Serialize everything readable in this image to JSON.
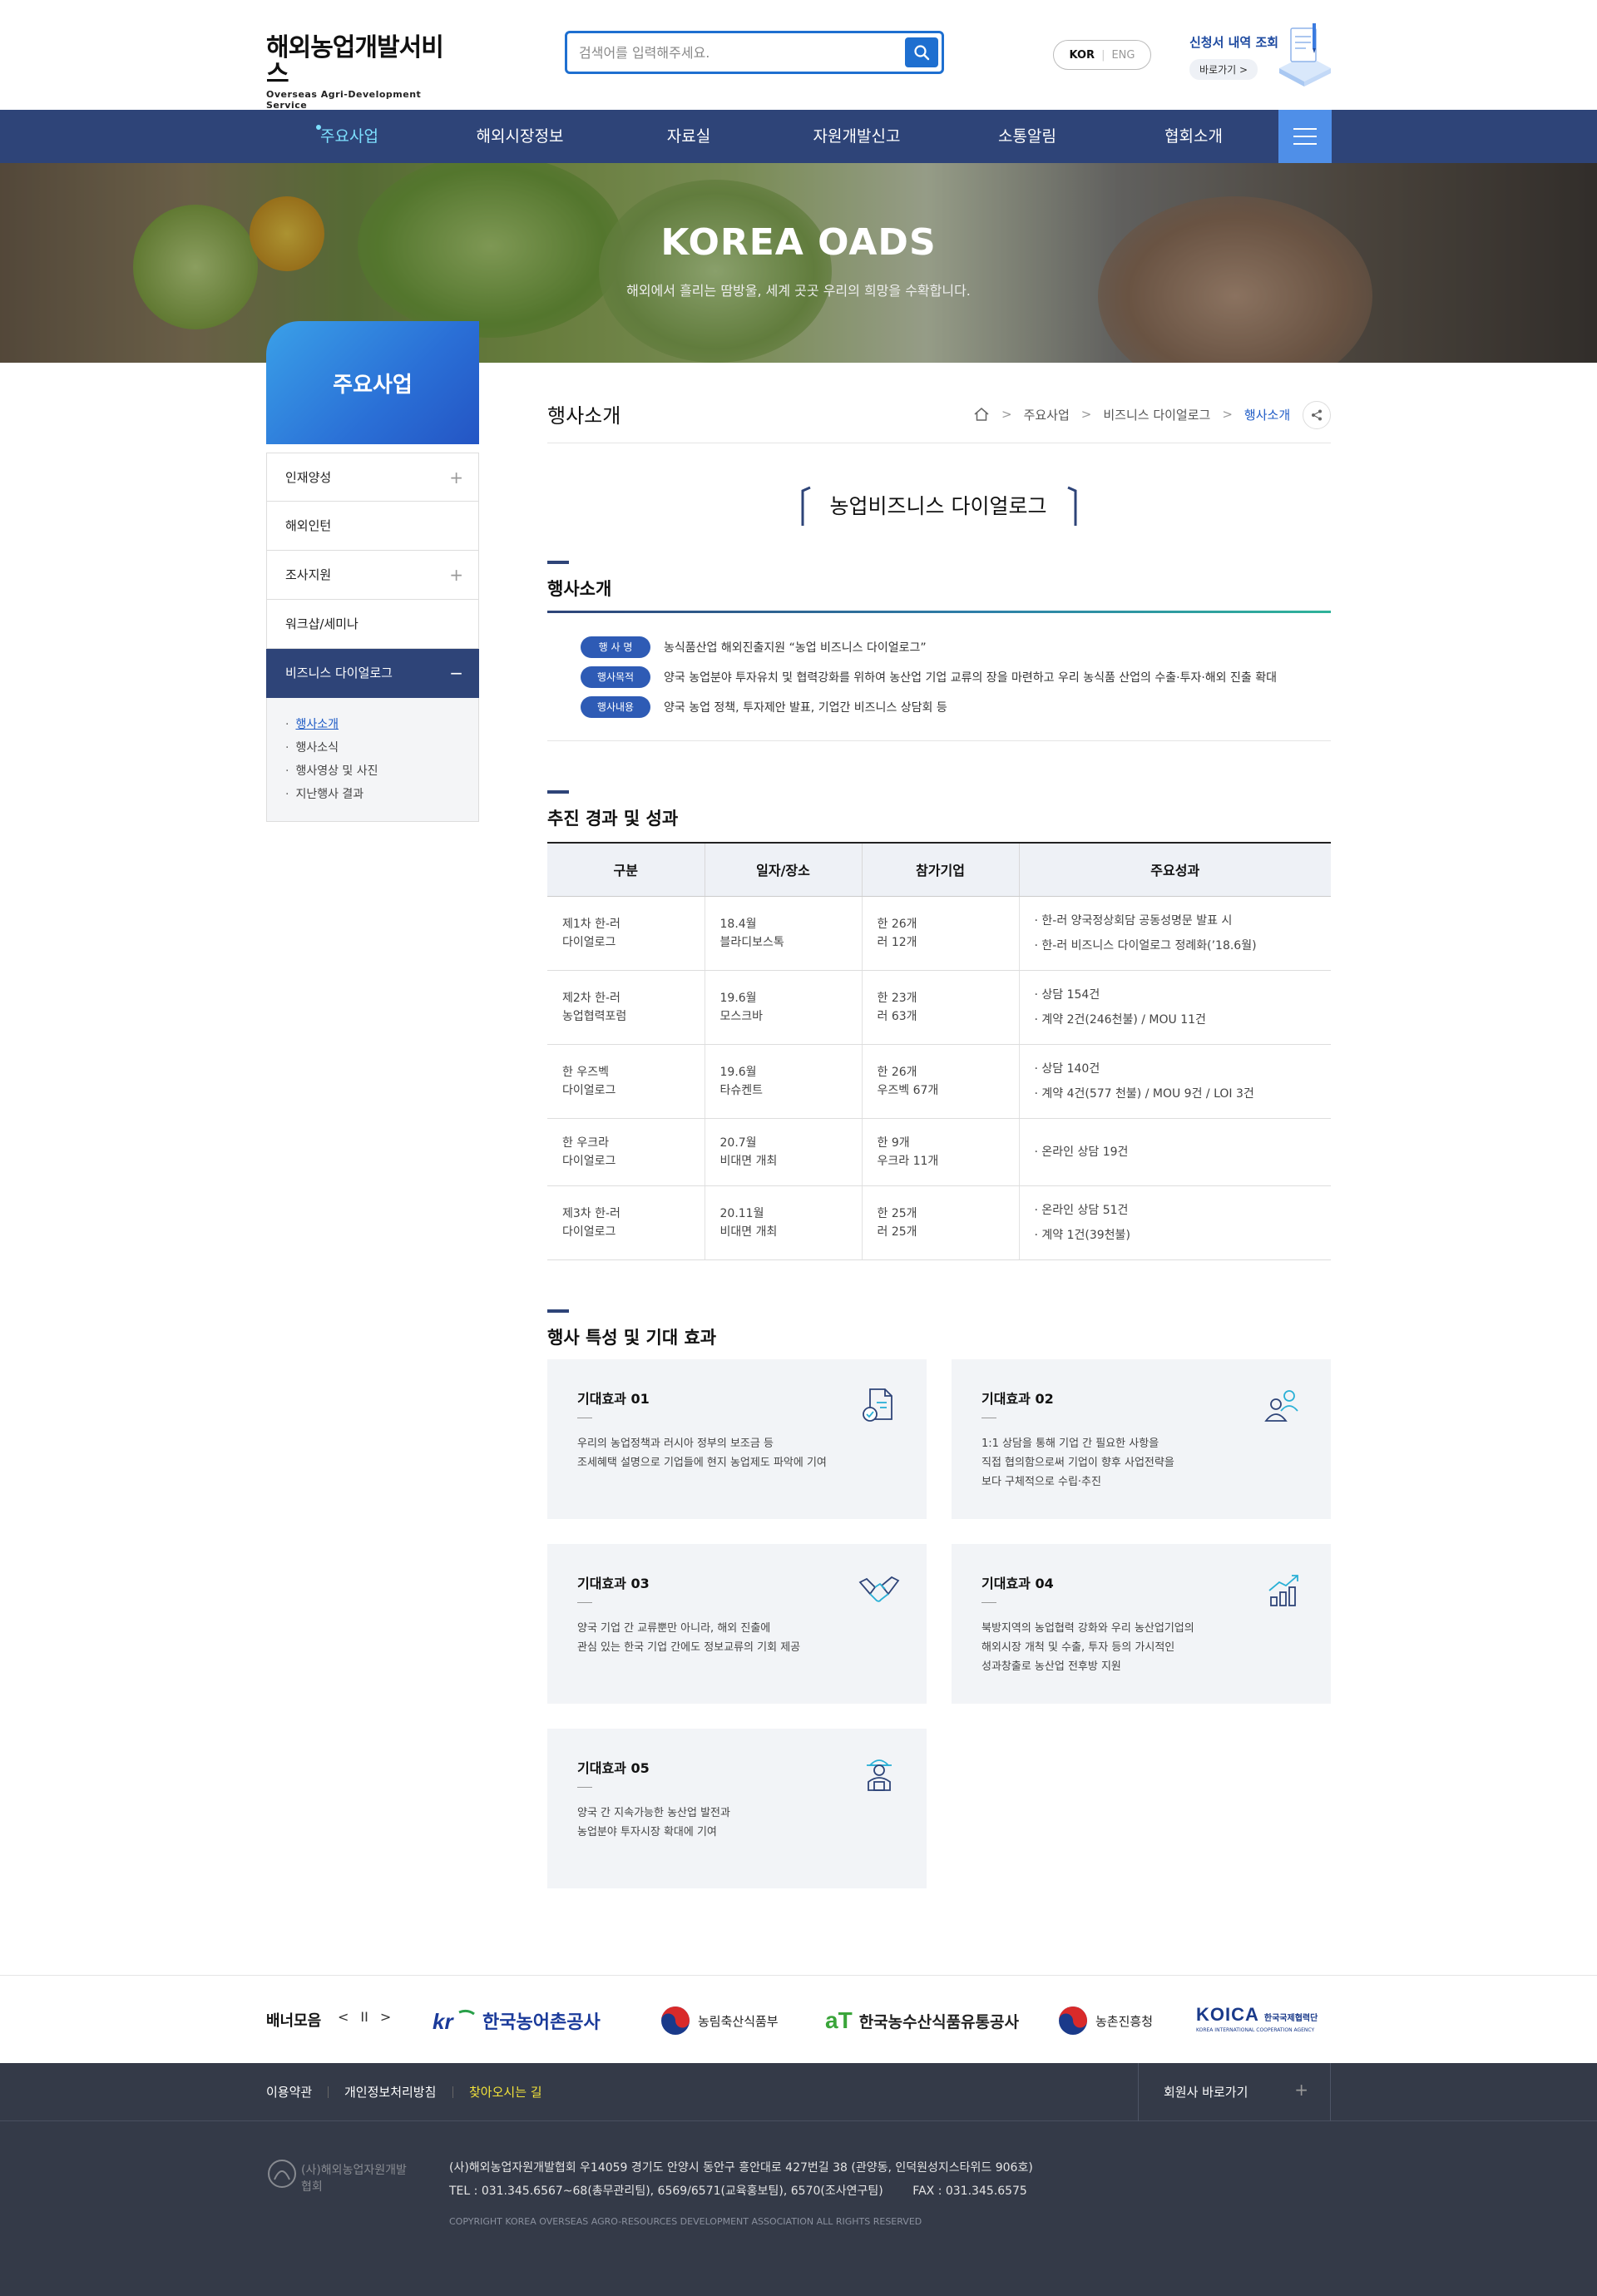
{
  "header": {
    "logo_main": "해외농업개발서비스",
    "logo_sub": "Overseas Agri-Development Service",
    "search_placeholder": "검색어를 입력해주세요.",
    "lang_kor": "KOR",
    "lang_eng": "ENG",
    "apply_title": "신청서 내역 조회",
    "apply_go": "바로가기 >"
  },
  "gnb": {
    "items": [
      "주요사업",
      "해외시장정보",
      "자료실",
      "자원개발신고",
      "소통알림",
      "협회소개"
    ]
  },
  "banner": {
    "title": "KOREA OADS",
    "subtitle": "해외에서 흘리는 땀방울, 세계 곳곳 우리의 희망을 수확합니다."
  },
  "lnb": {
    "title": "주요사업",
    "items": [
      "인재양성",
      "해외인턴",
      "조사지원",
      "워크샵/세미나",
      "비즈니스 다이얼로그"
    ],
    "sub": [
      "행사소개",
      "행사소식",
      "행사영상 및 사진",
      "지난행사 결과"
    ]
  },
  "content": {
    "page_title": "행사소개",
    "breadcrumb": [
      "주요사업",
      "비즈니스 다이얼로그",
      "행사소개"
    ],
    "event_title": "농업비즈니스 다이얼로그",
    "section1": {
      "title": "행사소개",
      "rows": [
        {
          "badge": "행 사 명",
          "text": "농식품산업 해외진출지원 “농업 비즈니스 다이얼로그”"
        },
        {
          "badge": "행사목적",
          "text": "양국 농업분야 투자유치 및 협력강화를 위하여 농산업 기업 교류의 장을 마련하고 우리 농식품 산업의 수출·투자·해외 진출 확대"
        },
        {
          "badge": "행사내용",
          "text": "양국 농업 정책, 투자제안 발표, 기업간 비즈니스 상담회 등"
        }
      ]
    },
    "section2": {
      "title": "추진 경과 및 성과",
      "headers": [
        "구분",
        "일자/장소",
        "참가기업",
        "주요성과"
      ],
      "rows": [
        {
          "c1": [
            "제1차 한-러",
            "다이얼로그"
          ],
          "c2": [
            "18.4월",
            "블라디보스톡"
          ],
          "c3": [
            "한 26개",
            "러 12개"
          ],
          "c4": [
            "한-러 양국정상회담 공동성명문 발표 시",
            "한-러 비즈니스 다이얼로그 정례화(’18.6월)"
          ]
        },
        {
          "c1": [
            "제2차 한-러",
            "농업협력포럼"
          ],
          "c2": [
            "19.6월",
            "모스크바"
          ],
          "c3": [
            "한 23개",
            "러 63개"
          ],
          "c4": [
            "상담 154건",
            "계약 2건(246천불) / MOU 11건"
          ]
        },
        {
          "c1": [
            "한 우즈벡",
            "다이얼로그"
          ],
          "c2": [
            "19.6월",
            "타슈켄트"
          ],
          "c3": [
            "한 26개",
            "우즈벡 67개"
          ],
          "c4": [
            "상담 140건",
            "계약 4건(577 천불) / MOU 9건 / LOI 3건"
          ]
        },
        {
          "c1": [
            "한 우크라",
            "다이얼로그"
          ],
          "c2": [
            "20.7월",
            "비대면 개최"
          ],
          "c3": [
            "한 9개",
            "우크라 11개"
          ],
          "c4": [
            "온라인 상담 19건"
          ]
        },
        {
          "c1": [
            "제3차 한-러",
            "다이얼로그"
          ],
          "c2": [
            "20.11월",
            "비대면 개최"
          ],
          "c3": [
            "한 25개",
            "러 25개"
          ],
          "c4": [
            "온라인 상담 51건",
            "계약 1건(39천불)"
          ]
        }
      ]
    },
    "section3": {
      "title": "행사 특성 및 기대 효과",
      "cards": [
        {
          "title": "기대효과 01",
          "lines": [
            "우리의 농업정책과 러시아 정부의 보조금 등",
            "조세혜택 설명으로 기업들에 현지 농업제도 파악에 기여"
          ],
          "icon": "document-check-icon"
        },
        {
          "title": "기대효과 02",
          "lines": [
            "1:1 상담을 통해 기업 간 필요한 사항을",
            "직접 협의함으로써 기업이 향후 사업전략을",
            "보다 구체적으로 수립·추진"
          ],
          "icon": "users-icon"
        },
        {
          "title": "기대효과 03",
          "lines": [
            "양국 기업 간 교류뿐만 아니라, 해외 진출에",
            "관심 있는 한국 기업 간에도 정보교류의 기회 제공"
          ],
          "icon": "handshake-icon"
        },
        {
          "title": "기대효과 04",
          "lines": [
            "북방지역의 농업협력 강화와 우리 농산업기업의",
            "해외시장 개척 및 수출, 투자 등의 가시적인",
            "성과창출로 농산업 전후방 지원"
          ],
          "icon": "growth-chart-icon"
        },
        {
          "title": "기대효과 05",
          "lines": [
            "양국 간 지속가능한 농산업 발전과",
            "농업분야 투자시장 확대에 기여"
          ],
          "icon": "farmer-icon"
        }
      ]
    }
  },
  "links": {
    "title": "배너모음",
    "ctrl": [
      "<",
      "II",
      ">"
    ],
    "partners": [
      "한국농어촌공사",
      "농림축산식품부",
      "한국농수산식품유통공사",
      "농촌진흥청",
      "KOICA",
      "한국국제협력단",
      "KOREA INTERNATIONAL COOPERATION AGENCY"
    ]
  },
  "footer": {
    "links": [
      "이용약관",
      "개인정보처리방침",
      "찾아오시는 길"
    ],
    "family": "회원사 바로가기",
    "logo_text": "(사)해외농업자원개발협회",
    "address": "(사)해외농업자원개발협회 우14059 경기도 안양시 동안구 흥안대로 427번길 38 (관양동, 인덕원성지스타위드 906호)",
    "tel": "TEL : 031.345.6567~68(총무관리팀), 6569/6571(교육홍보팀), 6570(조사연구팀)        FAX : 031.345.6575",
    "copyright": "COPYRIGHT KOREA OVERSEAS AGRO-RESOURCES DEVELOPMENT ASSOCIATION ALL RIGHTS RESERVED"
  },
  "colors": {
    "navy": "#2e4478",
    "accent_blue": "#1e6fd0",
    "badge_blue": "#2e5bb5",
    "highlight_cyan": "#7de0ff",
    "footer_bg": "#343a48",
    "footer_highlight": "#f3e33a"
  }
}
